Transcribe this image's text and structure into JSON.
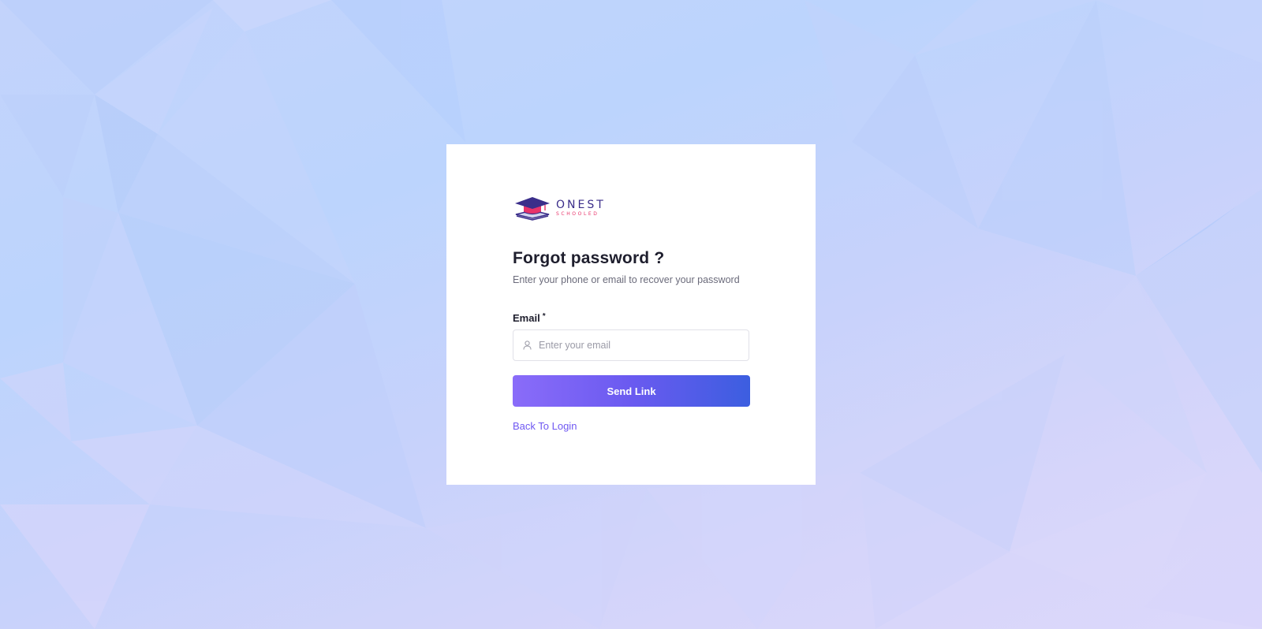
{
  "brand": {
    "name_main": "ONEST",
    "name_sub": "SCHOOLED",
    "primary_color": "#3b2e8a",
    "accent_color": "#e8336a"
  },
  "form": {
    "title": "Forgot password ?",
    "subtitle": "Enter your phone or email to recover your password",
    "email_label": "Email",
    "required_mark": "*",
    "email_value": "",
    "email_placeholder": "Enter your email",
    "email_icon": "user-icon",
    "submit_label": "Send Link",
    "back_link_label": "Back To Login"
  },
  "colors": {
    "button_gradient_start": "#8a6cf9",
    "button_gradient_end": "#3c5ee0",
    "link": "#6f58f2"
  }
}
